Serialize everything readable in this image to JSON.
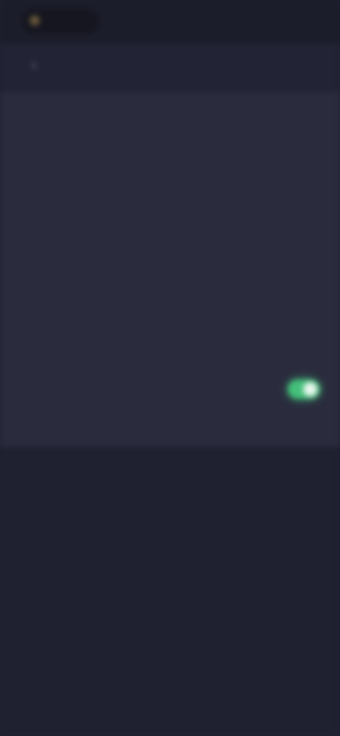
{
  "status_bar": {
    "app_label": "",
    "right_text": ""
  },
  "header": {
    "back_icon": "chevron-left-icon",
    "title": ""
  },
  "settings": {
    "items": [
      {
        "label": "",
        "control": "none"
      },
      {
        "label": "",
        "control": "none"
      },
      {
        "label": "",
        "control": "none"
      },
      {
        "label": "",
        "control": "none"
      },
      {
        "label": "",
        "control": "none"
      },
      {
        "label": "",
        "control": "none"
      },
      {
        "label": "",
        "control": "none"
      },
      {
        "label": "",
        "control": "toggle",
        "toggle_on": true
      },
      {
        "label": "",
        "control": "none"
      }
    ]
  },
  "colors": {
    "background": "#1f2030",
    "panel": "#2a2b3d",
    "toggle_on": "#44c07a"
  }
}
